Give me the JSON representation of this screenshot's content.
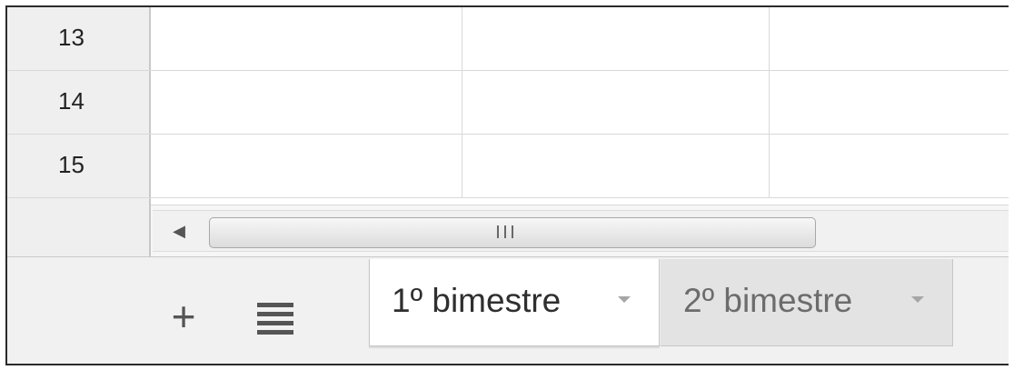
{
  "spreadsheet": {
    "rows": [
      {
        "number": "13"
      },
      {
        "number": "14"
      },
      {
        "number": "15"
      }
    ]
  },
  "toolbar": {
    "add_sheet_icon": "plus-icon",
    "sheet_list_icon": "menu-icon",
    "scroll_left_icon": "chevron-left-icon"
  },
  "sheets": [
    {
      "label": "1º bimestre",
      "active": true
    },
    {
      "label": "2º bimestre",
      "active": false
    }
  ],
  "colors": {
    "row_header_bg": "#efefef",
    "sheet_bar_bg": "#f1f1f1",
    "active_tab_bg": "#ffffff",
    "inactive_tab_bg": "#e3e3e3"
  }
}
